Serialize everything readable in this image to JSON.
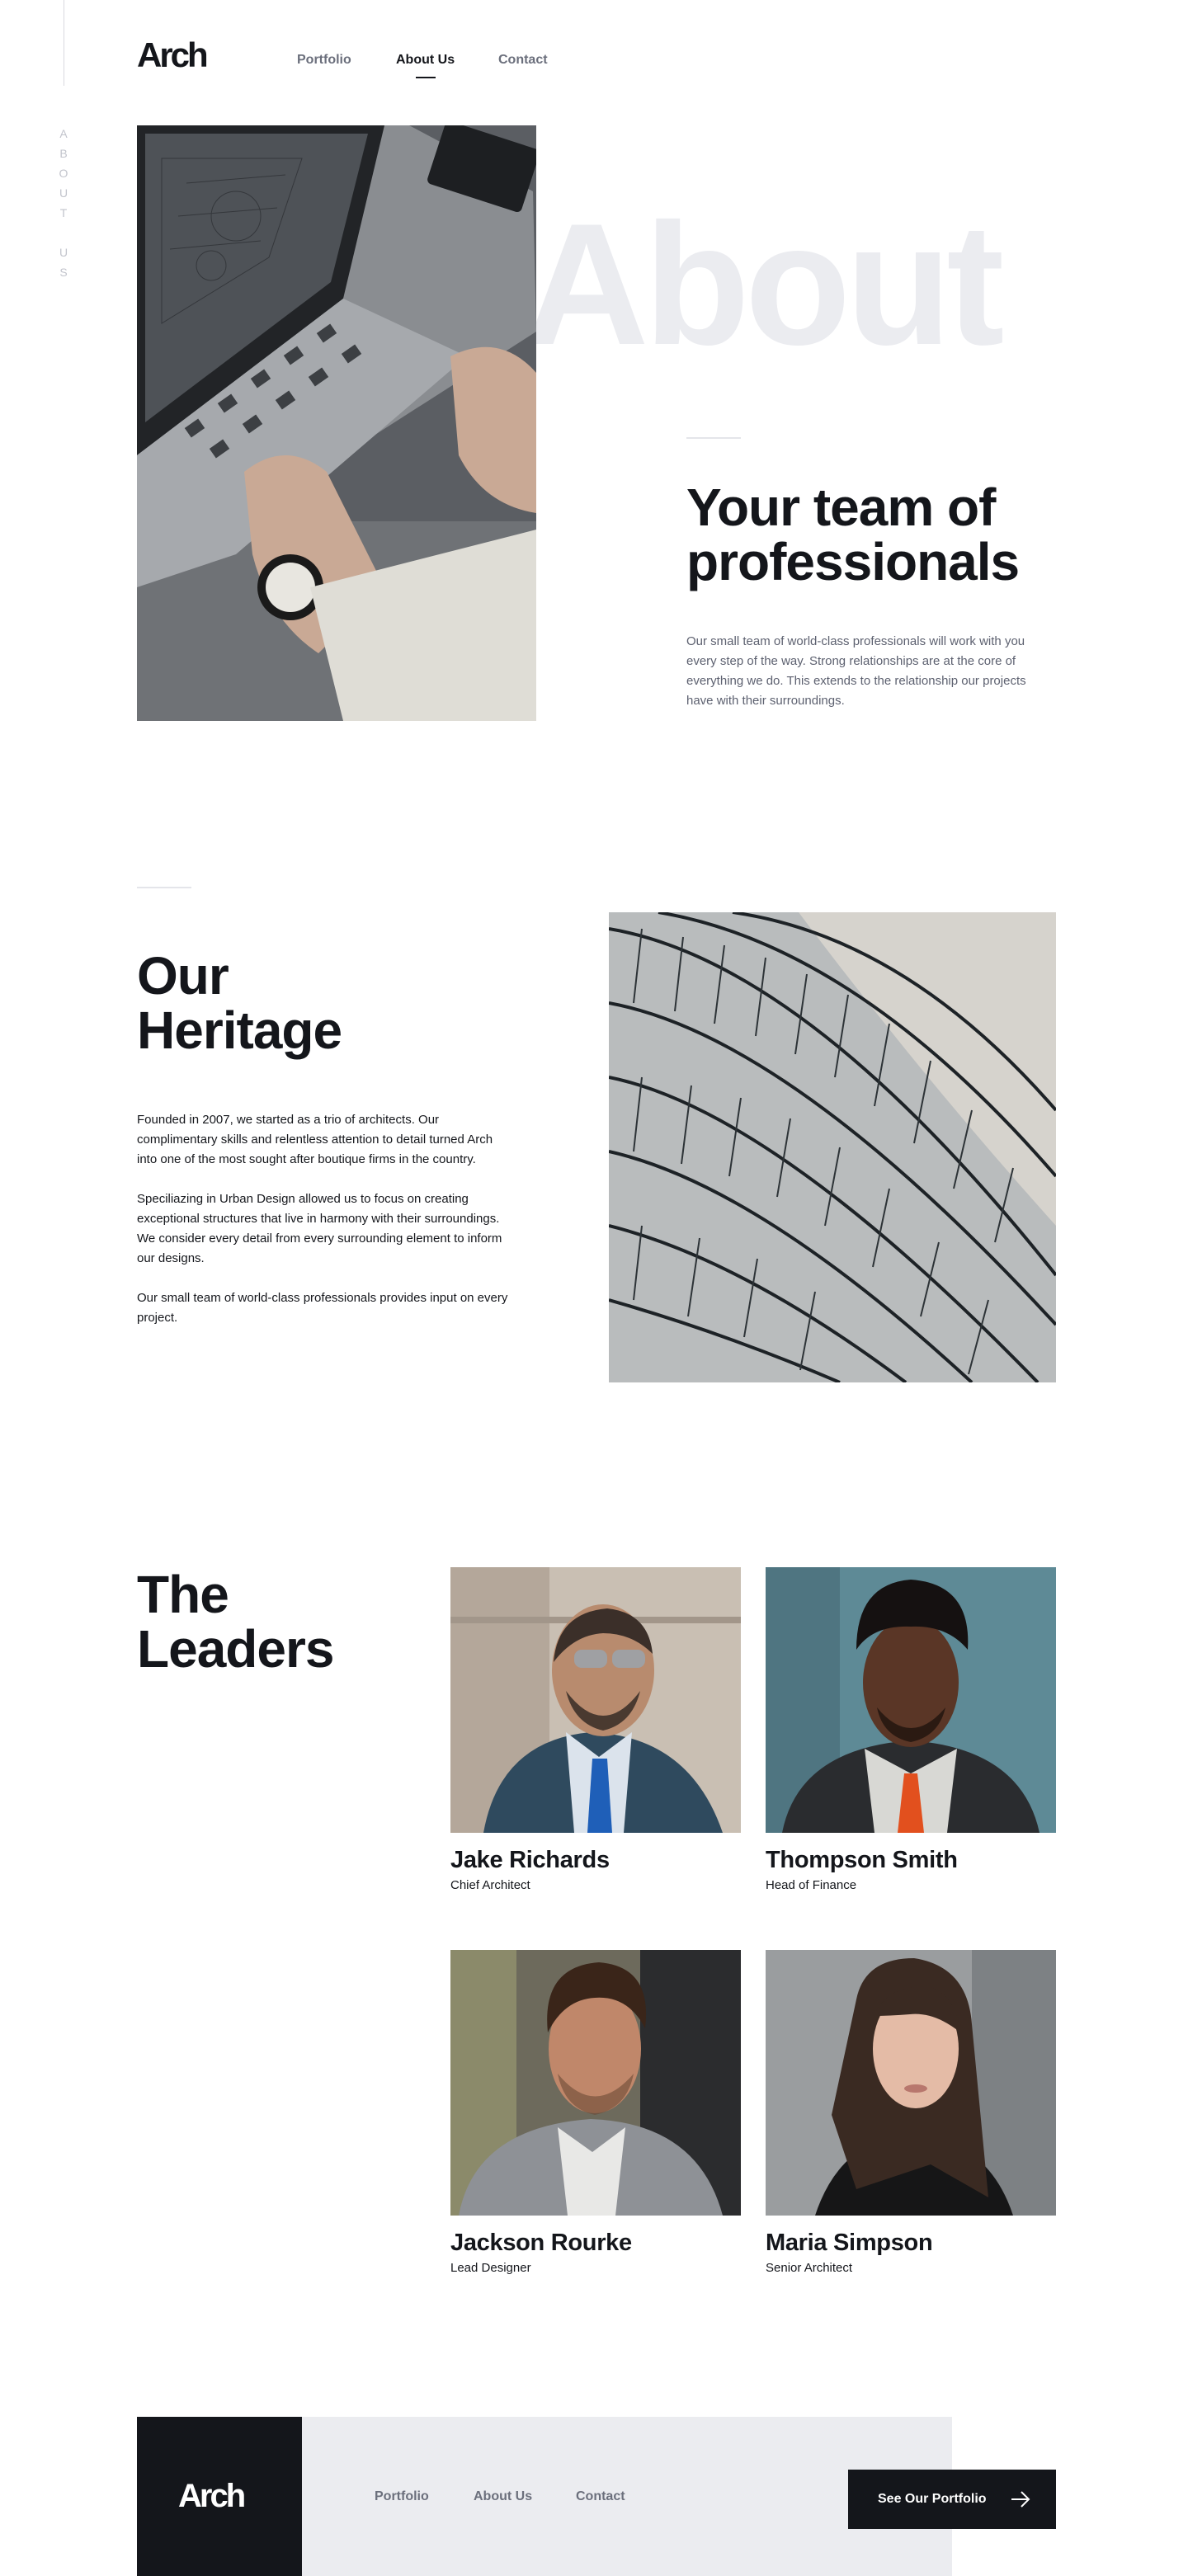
{
  "side_label": "ABOUT US",
  "header": {
    "logo": "Arch",
    "nav": [
      {
        "label": "Portfolio"
      },
      {
        "label": "About Us"
      },
      {
        "label": "Contact"
      }
    ]
  },
  "hero": {
    "background_word": "About",
    "title": "Your team of professionals",
    "body": "Our small team of world-class professionals will work with you every step of the way. Strong relationships are at the core of everything we do. This extends to the relationship our projects have with their surroundings."
  },
  "heritage": {
    "title": "Our Heritage",
    "paragraphs": [
      "Founded in 2007, we started as a trio of architects. Our complimentary skills and relentless attention to detail turned Arch into one of the most sought after boutique firms in the country.",
      "Speciliazing in Urban Design allowed us to focus on creating exceptional structures that live in harmony with their surroundings. We consider every detail from every surrounding element to inform our designs.",
      "Our small team of world-class professionals provides input on every project."
    ]
  },
  "leaders": {
    "title": "The Leaders",
    "people": [
      {
        "name": "Jake Richards",
        "role": "Chief Architect"
      },
      {
        "name": "Thompson Smith",
        "role": "Head of Finance"
      },
      {
        "name": "Jackson Rourke",
        "role": "Lead Designer"
      },
      {
        "name": "Maria Simpson",
        "role": "Senior Architect"
      }
    ]
  },
  "footer": {
    "logo": "Arch",
    "nav": [
      {
        "label": "Portfolio"
      },
      {
        "label": "About Us"
      },
      {
        "label": "Contact"
      }
    ],
    "cta_label": "See Our Portfolio",
    "cta_icon": "arrow-right-icon"
  },
  "colors": {
    "ink": "#14161b",
    "muted": "#6b6f7c",
    "pale": "#ebecf0"
  }
}
